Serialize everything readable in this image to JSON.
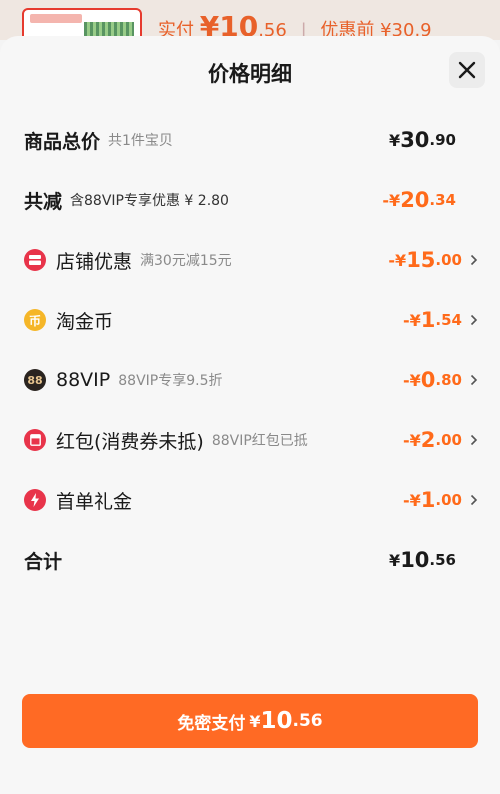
{
  "background": {
    "prefix": "实付",
    "amount_int": "¥10",
    "amount_dec": ".56",
    "divider": "|",
    "orig": "优惠前 ¥30.9"
  },
  "sheet": {
    "title": "价格明细",
    "close_symbol": "×"
  },
  "rows": [
    {
      "label": "商品总价",
      "sub": "共1件宝贝",
      "cur": "¥",
      "int": "30",
      "dec": ".90"
    },
    {
      "label": "共减",
      "sub": "含88VIP专享优惠 ¥ 2.80",
      "cur": "-¥",
      "int": "20",
      "dec": ".34"
    },
    {
      "label": "店铺优惠",
      "sub": "满30元减15元",
      "cur": "-¥",
      "int": "15",
      "dec": ".00",
      "icon": "shop-discount-icon"
    },
    {
      "label": "淘金币",
      "sub": "",
      "cur": "-¥",
      "int": "1",
      "dec": ".54",
      "icon": "taojinbi-coin-icon",
      "icon_text": "币"
    },
    {
      "label": "88VIP",
      "sub": "88VIP专享9.5折",
      "cur": "-¥",
      "int": "0",
      "dec": ".80",
      "icon": "88vip-icon",
      "icon_text": "88"
    },
    {
      "label": "红包(消费券未抵)",
      "sub": "88VIP红包已抵",
      "cur": "-¥",
      "int": "2",
      "dec": ".00",
      "icon": "red-envelope-icon"
    },
    {
      "label": "首单礼金",
      "sub": "",
      "cur": "-¥",
      "int": "1",
      "dec": ".00",
      "icon": "first-order-gift-icon"
    },
    {
      "label": "合计",
      "sub": "",
      "cur": "¥",
      "int": "10",
      "dec": ".56"
    }
  ],
  "pay_button": {
    "label": "免密支付",
    "cur": "¥",
    "int": "10",
    "dec": ".56"
  },
  "colors": {
    "accent": "#ff6a24",
    "amount_orange": "#ff6a1a",
    "shop_red": "#e8344a",
    "coin_gold": "#f5b628",
    "vip_dark": "#2a2420"
  }
}
